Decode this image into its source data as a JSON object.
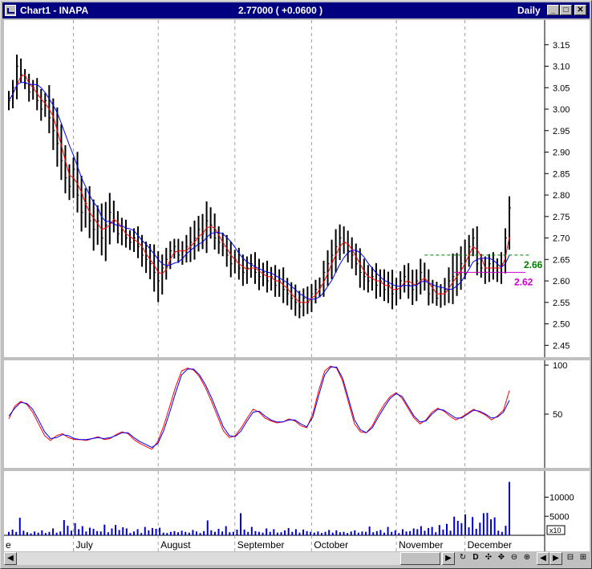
{
  "window": {
    "title": "Chart1 - INAPA",
    "price_readout": "2.77000 ( +0.0600 )",
    "period": "Daily"
  },
  "colors": {
    "titlebar": "#000080",
    "bars": "#000000",
    "ma_fast": "#ff0000",
    "ma_slow": "#0000ff",
    "resistance": "#008000",
    "support": "#cc00cc",
    "volume": "#0000cc"
  },
  "annotations": {
    "resistance_label": "2.66",
    "support_label": "2.62"
  },
  "x_axis": {
    "months": [
      "e",
      "July",
      "August",
      "September",
      "October",
      "November",
      "December"
    ]
  },
  "toolbar": {
    "zoom_label": "D"
  },
  "chart_data": [
    {
      "type": "bar",
      "subtype": "ohlc",
      "title": "INAPA",
      "ylim": [
        2.43,
        3.2
      ],
      "yticks": [
        3.15,
        3.1,
        3.05,
        3.0,
        2.95,
        2.9,
        2.85,
        2.8,
        2.75,
        2.7,
        2.65,
        2.6,
        2.55,
        2.5,
        2.45
      ],
      "ytick_labels": [
        "3.15",
        "3.10",
        "3.05",
        "3.00",
        "2.95",
        "2.90",
        "2.85",
        "2.80",
        "2.75",
        "2.70",
        "2.65",
        "2.60",
        "2.55",
        "2.50",
        "2.45"
      ],
      "month_starts": {
        "July": 16,
        "August": 37,
        "September": 56,
        "October": 75,
        "November": 96,
        "December": 113
      },
      "n_bars": 125,
      "close": [
        3.02,
        3.05,
        3.1,
        3.08,
        3.06,
        3.04,
        3.05,
        3.02,
        3.0,
        3.02,
        2.98,
        2.95,
        2.92,
        2.88,
        2.84,
        2.82,
        2.86,
        2.8,
        2.76,
        2.78,
        2.74,
        2.72,
        2.74,
        2.7,
        2.73,
        2.76,
        2.74,
        2.71,
        2.72,
        2.7,
        2.69,
        2.7,
        2.68,
        2.66,
        2.65,
        2.64,
        2.62,
        2.6,
        2.63,
        2.65,
        2.67,
        2.68,
        2.66,
        2.67,
        2.68,
        2.69,
        2.7,
        2.72,
        2.71,
        2.74,
        2.73,
        2.7,
        2.69,
        2.68,
        2.66,
        2.64,
        2.65,
        2.63,
        2.62,
        2.63,
        2.64,
        2.62,
        2.61,
        2.62,
        2.6,
        2.61,
        2.59,
        2.6,
        2.58,
        2.57,
        2.56,
        2.55,
        2.54,
        2.56,
        2.55,
        2.57,
        2.58,
        2.59,
        2.62,
        2.64,
        2.66,
        2.68,
        2.7,
        2.69,
        2.67,
        2.66,
        2.64,
        2.62,
        2.61,
        2.6,
        2.61,
        2.59,
        2.6,
        2.58,
        2.59,
        2.57,
        2.58,
        2.6,
        2.61,
        2.59,
        2.58,
        2.6,
        2.62,
        2.6,
        2.57,
        2.58,
        2.56,
        2.57,
        2.58,
        2.6,
        2.61,
        2.62,
        2.64,
        2.66,
        2.68,
        2.7,
        2.64,
        2.63,
        2.62,
        2.64,
        2.63,
        2.62,
        2.64,
        2.7,
        2.77
      ],
      "high_low_range": [
        0.05,
        0.04,
        0.06,
        0.04,
        0.03,
        0.05,
        0.04,
        0.05,
        0.06,
        0.04,
        0.08,
        0.1,
        0.12,
        0.1,
        0.08,
        0.07,
        0.06,
        0.09,
        0.1,
        0.08,
        0.09,
        0.11,
        0.08,
        0.09,
        0.12,
        0.1,
        0.06,
        0.05,
        0.06,
        0.05,
        0.04,
        0.05,
        0.06,
        0.06,
        0.07,
        0.08,
        0.1,
        0.11,
        0.07,
        0.06,
        0.05,
        0.04,
        0.04,
        0.05,
        0.06,
        0.08,
        0.09,
        0.07,
        0.08,
        0.1,
        0.07,
        0.06,
        0.06,
        0.05,
        0.06,
        0.07,
        0.05,
        0.06,
        0.07,
        0.06,
        0.05,
        0.06,
        0.07,
        0.05,
        0.06,
        0.05,
        0.06,
        0.06,
        0.07,
        0.06,
        0.06,
        0.07,
        0.06,
        0.05,
        0.06,
        0.05,
        0.05,
        0.04,
        0.06,
        0.07,
        0.08,
        0.09,
        0.07,
        0.06,
        0.06,
        0.07,
        0.06,
        0.08,
        0.07,
        0.06,
        0.05,
        0.07,
        0.06,
        0.06,
        0.07,
        0.08,
        0.06,
        0.05,
        0.06,
        0.07,
        0.08,
        0.06,
        0.07,
        0.05,
        0.06,
        0.05,
        0.04,
        0.05,
        0.06,
        0.07,
        0.12,
        0.1,
        0.09,
        0.08,
        0.06,
        0.05,
        0.06,
        0.05,
        0.06,
        0.05,
        0.06,
        0.05,
        0.06,
        0.05,
        0.06
      ],
      "series": [
        {
          "name": "",
          "kind": "moving-average-fast",
          "color": "#ff0000"
        },
        {
          "name": "",
          "kind": "moving-average-slow",
          "color": "#0000ff"
        }
      ],
      "levels": [
        {
          "value": 2.66,
          "label": "2.66",
          "color": "#008000",
          "style": "dashed",
          "from_bar": 103
        },
        {
          "value": 2.62,
          "label": "2.62",
          "color": "#cc00cc",
          "style": "solid",
          "from_bar": 110
        }
      ],
      "grid": "vertical-dashed-at-month-starts"
    },
    {
      "type": "line",
      "title": "",
      "ylim": [
        0,
        100
      ],
      "yticks": [
        100,
        50
      ],
      "ytick_labels": [
        "100",
        "50"
      ],
      "series": [
        {
          "name": "",
          "color": "#ff0000",
          "values": [
            45,
            58,
            63,
            60,
            52,
            40,
            28,
            23,
            28,
            30,
            26,
            24,
            24,
            23,
            25,
            27,
            24,
            25,
            29,
            32,
            30,
            24,
            20,
            17,
            14,
            22,
            38,
            58,
            78,
            94,
            97,
            95,
            88,
            77,
            63,
            48,
            33,
            26,
            28,
            36,
            46,
            55,
            52,
            46,
            43,
            41,
            42,
            45,
            43,
            38,
            36,
            50,
            74,
            94,
            99,
            97,
            84,
            62,
            40,
            32,
            31,
            38,
            50,
            60,
            68,
            72,
            66,
            56,
            46,
            40,
            44,
            52,
            56,
            53,
            48,
            44,
            47,
            51,
            55,
            52,
            49,
            44,
            48,
            54,
            74
          ]
        },
        {
          "name": "",
          "color": "#0000ff",
          "values": [
            48,
            56,
            62,
            61,
            55,
            44,
            32,
            25,
            26,
            29,
            28,
            25,
            24,
            24,
            25,
            26,
            25,
            26,
            28,
            31,
            31,
            26,
            22,
            19,
            16,
            20,
            33,
            52,
            72,
            90,
            96,
            96,
            90,
            80,
            67,
            52,
            37,
            28,
            27,
            33,
            43,
            52,
            53,
            48,
            44,
            42,
            42,
            44,
            44,
            40,
            37,
            47,
            69,
            90,
            98,
            98,
            87,
            66,
            44,
            34,
            31,
            36,
            47,
            57,
            66,
            71,
            68,
            58,
            48,
            42,
            43,
            50,
            55,
            54,
            50,
            46,
            46,
            50,
            54,
            53,
            50,
            46,
            47,
            52,
            64
          ]
        }
      ]
    },
    {
      "type": "bar",
      "title": "",
      "ylim": [
        0,
        16000
      ],
      "yticks": [
        10000,
        5000
      ],
      "ytick_labels": [
        "10000",
        "5000"
      ],
      "multiplier_label": "x10",
      "color": "#0000cc",
      "values": [
        900,
        1500,
        900,
        4600,
        1200,
        800,
        500,
        1000,
        700,
        1300,
        600,
        900,
        1800,
        700,
        1000,
        4000,
        2500,
        1200,
        3200,
        1600,
        2400,
        1000,
        2000,
        1700,
        1100,
        1000,
        2800,
        800,
        1800,
        2700,
        1400,
        2100,
        1800,
        600,
        1000,
        1600,
        600,
        2200,
        1300,
        1900,
        1700,
        2000,
        700,
        600,
        900,
        1100,
        800,
        1200,
        900,
        700,
        1400,
        1000,
        600,
        1100,
        3900,
        1300,
        900,
        1700,
        1000,
        2400,
        800,
        900,
        1500,
        5800,
        1500,
        900,
        2200,
        1100,
        900,
        700,
        1800,
        900,
        1600,
        700,
        800,
        1300,
        1900,
        900,
        1600,
        700,
        1500,
        1100,
        900,
        700,
        1000,
        600,
        900,
        1400,
        700,
        1300,
        800,
        900,
        600,
        1000,
        1300,
        700,
        1000,
        900,
        2300,
        800,
        1100,
        1400,
        700,
        2200,
        900,
        1300,
        600,
        1600,
        1000,
        1100,
        1800,
        1600,
        2400,
        1200,
        1900,
        2200,
        800,
        2700,
        1500,
        3000,
        1200,
        4900,
        3800,
        3200,
        5500,
        2100,
        4800,
        1700,
        3300,
        5800,
        5900,
        4200,
        4700,
        1200,
        900,
        2500,
        14000
      ]
    }
  ]
}
